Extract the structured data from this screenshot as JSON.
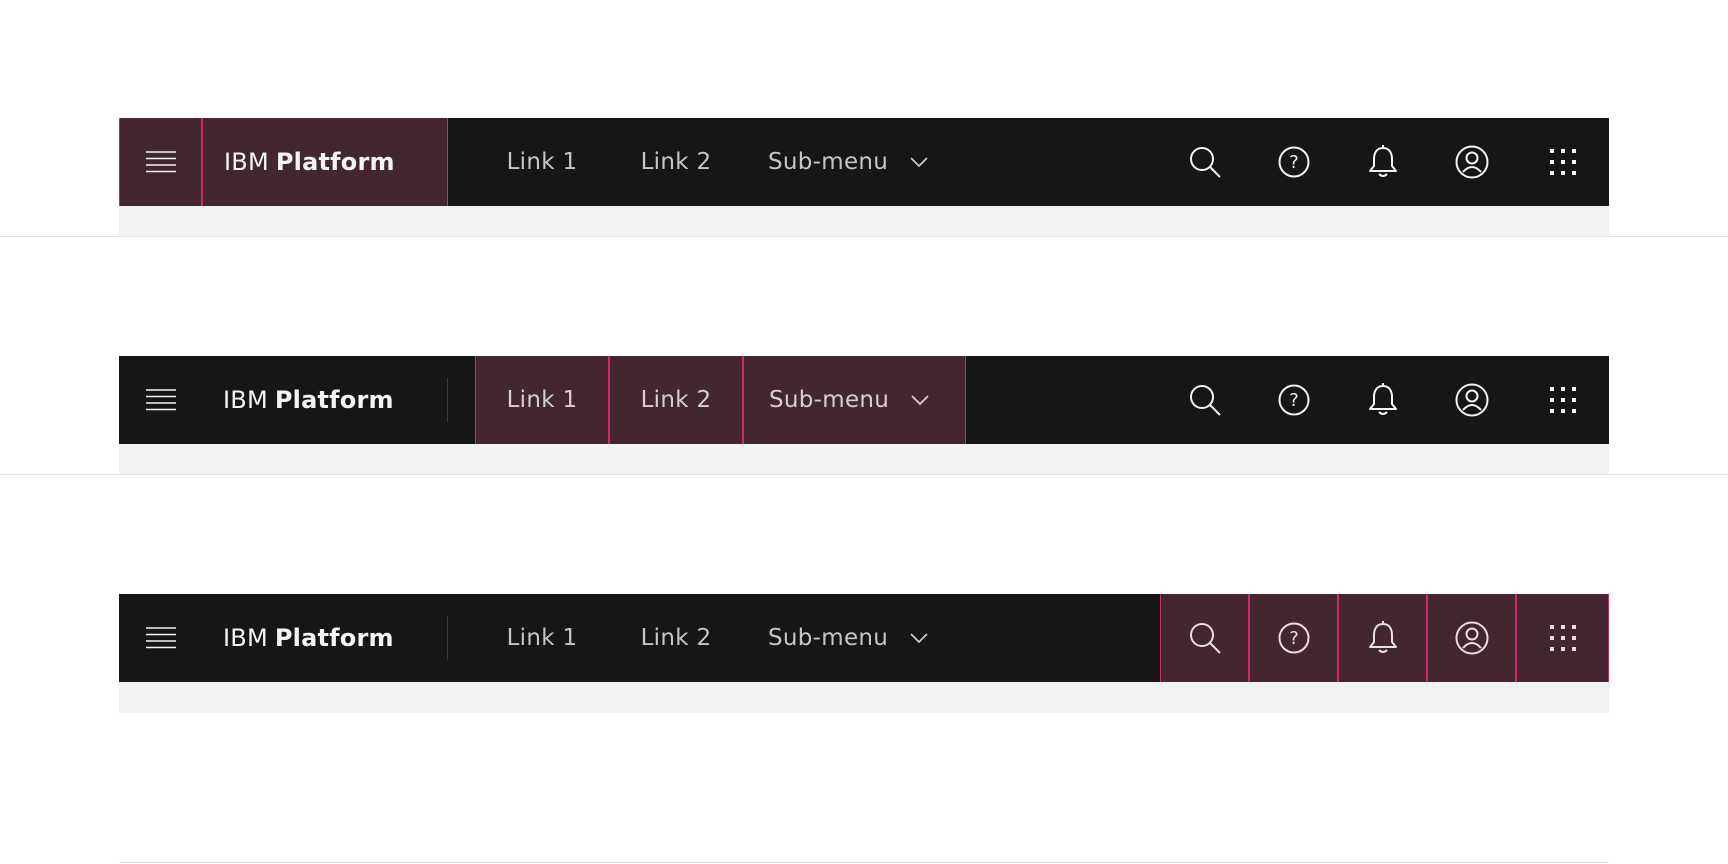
{
  "variants": [
    {
      "variant": "left-area",
      "brand": {
        "prefix": "IBM",
        "name": "Platform"
      },
      "nav": {
        "link1": "Link 1",
        "link2": "Link 2",
        "submenu": "Sub-menu"
      },
      "actions": [
        "search-icon",
        "help-icon",
        "notification-icon",
        "user-avatar-icon",
        "switcher-icon"
      ]
    },
    {
      "variant": "navigation-area",
      "brand": {
        "prefix": "IBM",
        "name": "Platform"
      },
      "nav": {
        "link1": "Link 1",
        "link2": "Link 2",
        "submenu": "Sub-menu"
      },
      "actions": [
        "search-icon",
        "help-icon",
        "notification-icon",
        "user-avatar-icon",
        "switcher-icon"
      ]
    },
    {
      "variant": "actions-area",
      "brand": {
        "prefix": "IBM",
        "name": "Platform"
      },
      "nav": {
        "link1": "Link 1",
        "link2": "Link 2",
        "submenu": "Sub-menu"
      },
      "actions": [
        "search-icon",
        "help-icon",
        "notification-icon",
        "user-avatar-icon",
        "switcher-icon"
      ]
    }
  ],
  "colors": {
    "header_bg": "#161616",
    "highlight_fill": "#442631",
    "highlight_border": "#d12771",
    "text_primary": "#f4f4f4",
    "text_nav": "#c6c6c6",
    "shelf": "#f2f2f2"
  }
}
